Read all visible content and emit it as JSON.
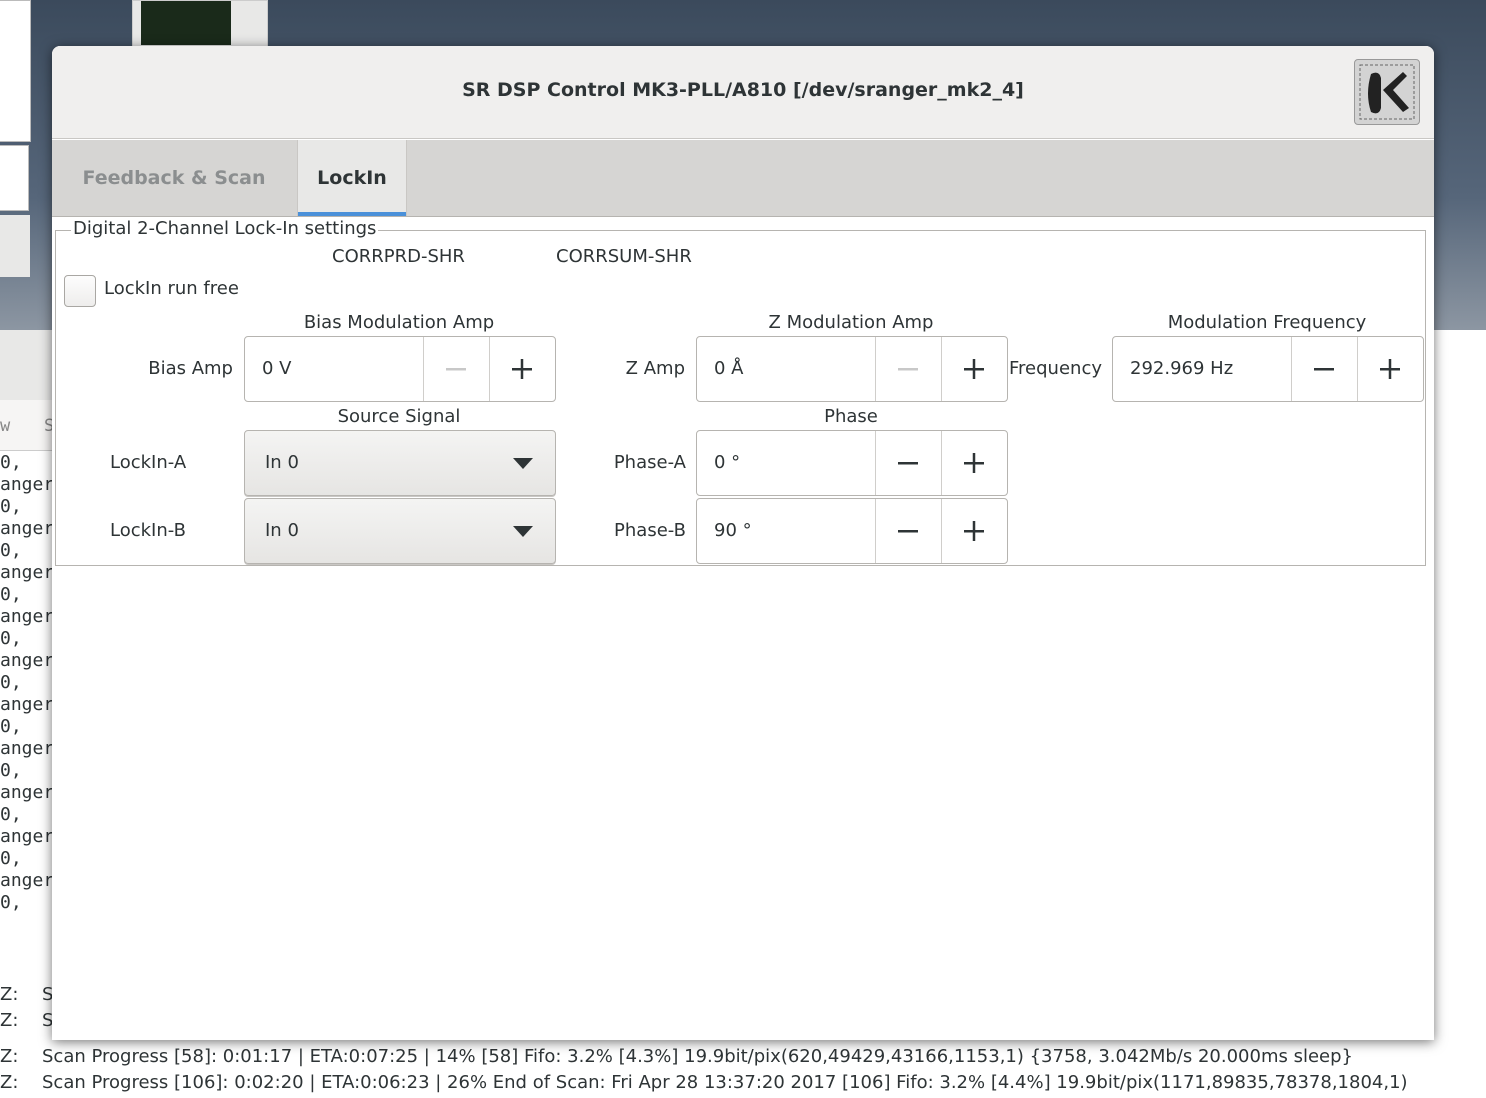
{
  "window": {
    "title": "SR DSP Control MK3-PLL/A810 [/dev/sranger_mk2_4]"
  },
  "tabs": [
    {
      "label": "Feedback & Scan",
      "active": false
    },
    {
      "label": "LockIn",
      "active": true
    }
  ],
  "lockin": {
    "frame_title": "Digital 2-Channel Lock-In settings",
    "corr_prd": "CORRPRD-SHR",
    "corr_sum": "CORRSUM-SHR",
    "run_free_label": "LockIn run free",
    "run_free_checked": false,
    "bias_section": "Bias Modulation Amp",
    "bias_label": "Bias Amp",
    "bias_value": "0 V",
    "z_section": "Z Modulation Amp",
    "z_label": "Z Amp",
    "z_value": "0 Å",
    "freq_section": "Modulation Frequency",
    "freq_label": "Frequency",
    "freq_value": "292.969 Hz",
    "source_section": "Source Signal",
    "lockin_a_label": "LockIn-A",
    "lockin_a_value": "In 0",
    "lockin_b_label": "LockIn-B",
    "lockin_b_value": "In 0",
    "phase_section": "Phase",
    "phase_a_label": "Phase-A",
    "phase_a_value": "0 °",
    "phase_b_label": "Phase-B",
    "phase_b_value": "90 °"
  },
  "background": {
    "term_col_a": "w",
    "term_col_b": "S",
    "term_lines": "0,\nanger\n0,\nanger\n0,\nanger\n0,\nanger\n0,   -\nanger\n0,   -\nanger\n0,   -\nanger\n0,   -\nanger\n0,   -\nanger\n0,   -\nanger\n0,   -",
    "status": [
      {
        "prefix": "Z:",
        "text": "S"
      },
      {
        "prefix": "Z:",
        "text": "S"
      },
      {
        "prefix": "Z:",
        "text": "Scan Progress [58]:   0:01:17 | ETA:0:07:25 | 14%  [58] Fifo: 3.2% [4.3%] 19.9bit/pix(620,49429,43166,1153,1) {3758, 3.042Mb/s 20.000ms sleep}"
      },
      {
        "prefix": "Z:",
        "text": "Scan Progress [106]:         0:02:20 | ETA:0:06:23 | 26% End of Scan: Fri Apr 28 13:37:20 2017  [106] Fifo: 3.2% [4.4%] 19.9bit/pix(1171,89835,78378,1804,1)"
      }
    ]
  },
  "colors": {
    "accent": "#4a90d9",
    "dialog_bg": "#ffffff",
    "titlebar_bg": "#f0efee",
    "tabbar_bg": "#d6d5d3"
  }
}
